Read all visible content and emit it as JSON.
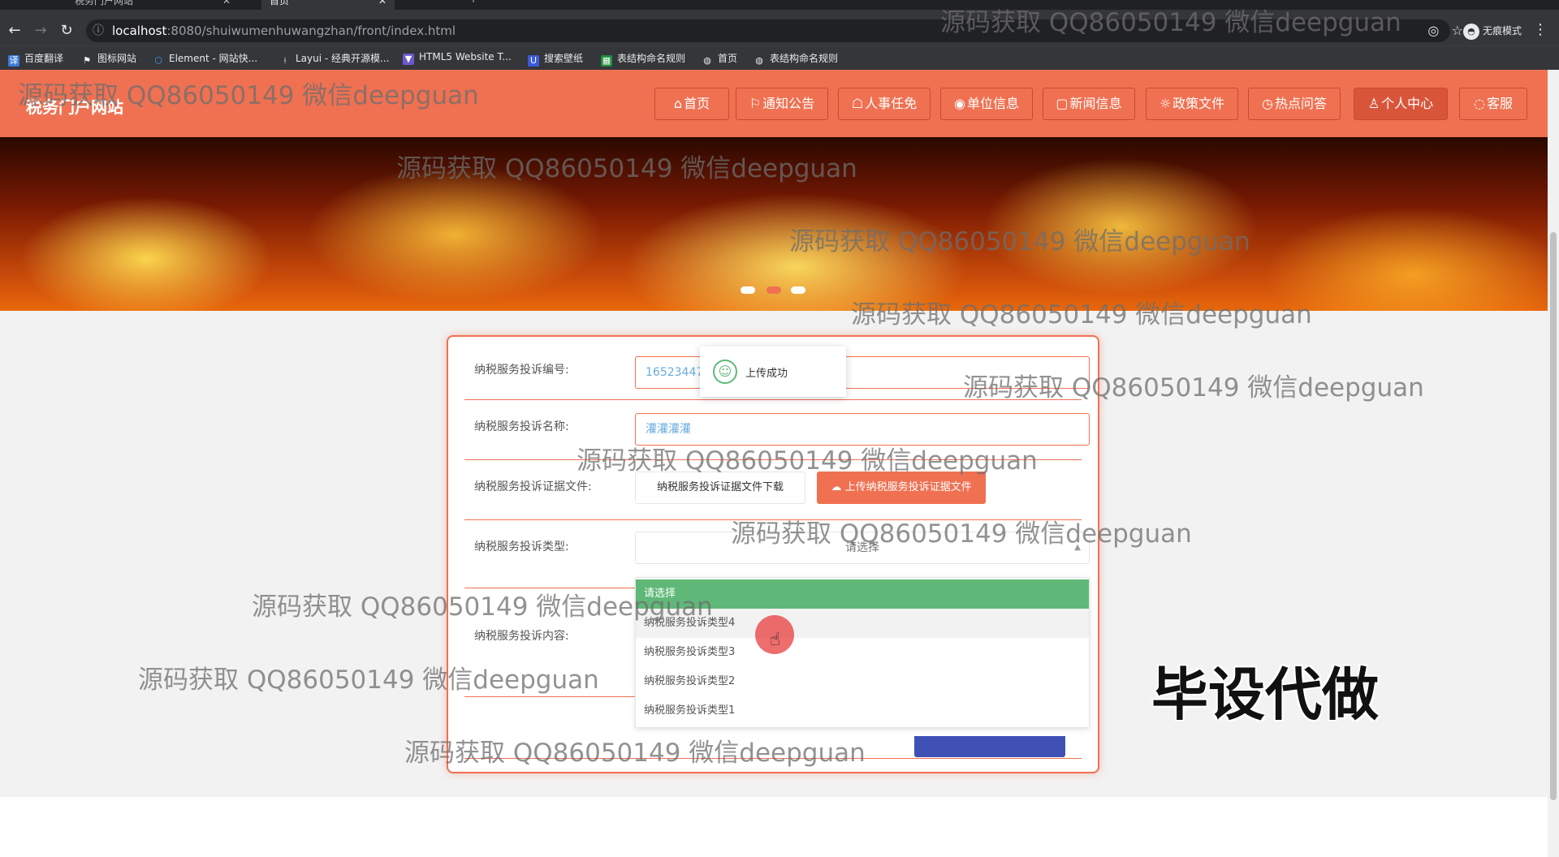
{
  "browser": {
    "tabs": [
      {
        "label": "税务门户网站",
        "active": false
      },
      {
        "label": "首页",
        "active": true
      }
    ],
    "new_tab": "+",
    "url_host": "localhost",
    "url_path": ":8080/shuiwumenhuwangzhan/front/index.html",
    "incognito_label": "无痕模式",
    "bookmarks": [
      "百度翻译",
      "图标网站",
      "Element - 网站快...",
      "Layui - 经典开源模...",
      "HTML5 Website T...",
      "搜索壁纸",
      "表结构命名规则",
      "首页",
      "表结构命名规则"
    ]
  },
  "site": {
    "logo": "税务门户网站",
    "nav": [
      {
        "icon": "⌂",
        "label": "首页"
      },
      {
        "icon": "⚐",
        "label": "通知公告"
      },
      {
        "icon": "☖",
        "label": "人事任免"
      },
      {
        "icon": "◉",
        "label": "单位信息"
      },
      {
        "icon": "▢",
        "label": "新闻信息"
      },
      {
        "icon": "☼",
        "label": "政策文件"
      },
      {
        "icon": "◷",
        "label": "热点问答"
      },
      {
        "icon": "♙",
        "label": "个人中心"
      },
      {
        "icon": "◌",
        "label": "客服"
      }
    ]
  },
  "form": {
    "fields": {
      "number_label": "纳税服务投诉编号:",
      "number_value": "1652344719",
      "name_label": "纳税服务投诉名称:",
      "name_value": "灌灌灌灌",
      "file_label": "纳税服务投诉证据文件:",
      "download_label": "纳税服务投诉证据文件下载",
      "upload_label": "上传纳税服务投诉证据文件",
      "type_label": "纳税服务投诉类型:",
      "type_placeholder": "请选择",
      "content_label": "纳税服务投诉内容:"
    },
    "dropdown_options": [
      "请选择",
      "纳税服务投诉类型4",
      "纳税服务投诉类型3",
      "纳税服务投诉类型2",
      "纳税服务投诉类型1"
    ]
  },
  "toast": {
    "message": "上传成功"
  },
  "watermarks": {
    "text": "源码获取 QQ86050149 微信deepguan",
    "big_text": "毕设代做"
  },
  "colors": {
    "primary": "#ef7152",
    "selected_option": "#5fb878",
    "submit": "#3f51b5"
  }
}
